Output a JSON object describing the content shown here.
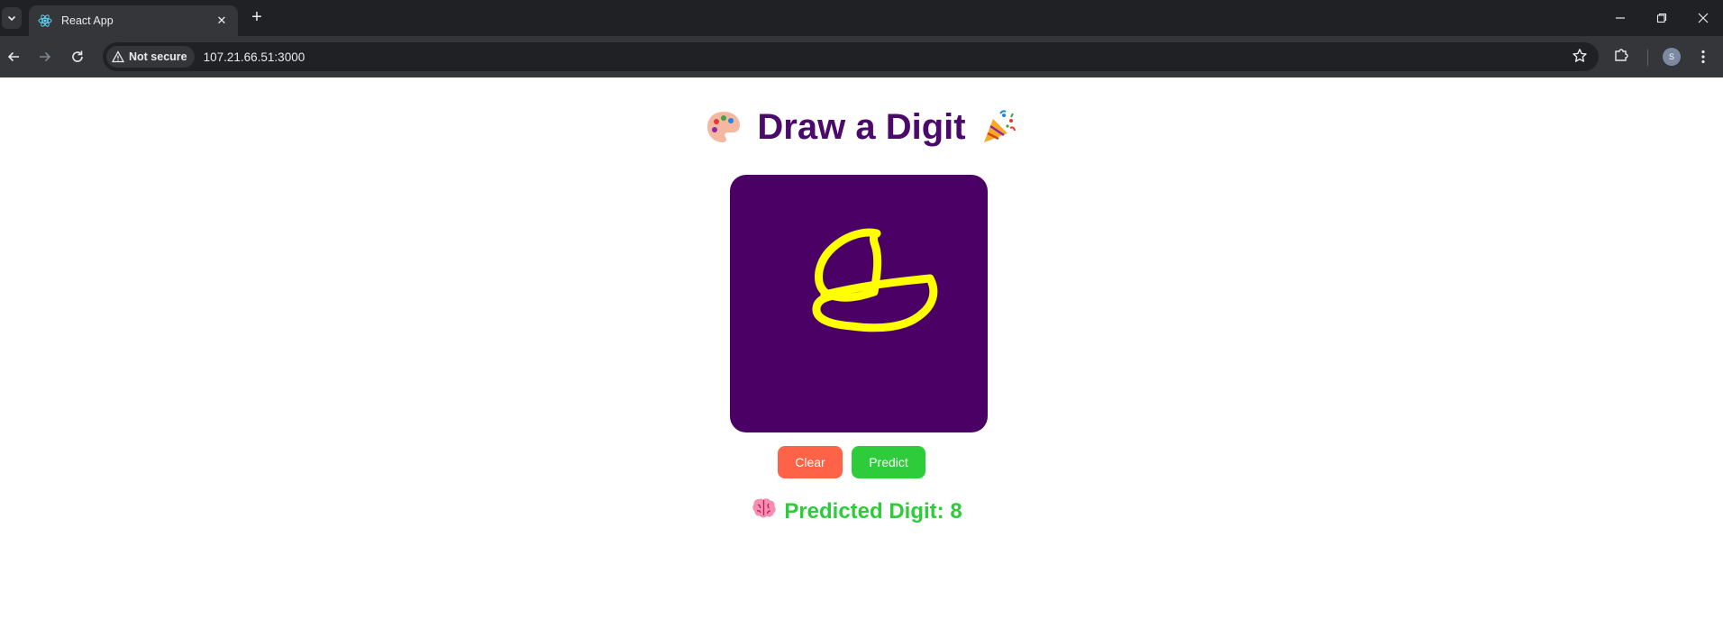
{
  "browser": {
    "tab_title": "React App",
    "security_label": "Not secure",
    "url": "107.21.66.51:3000",
    "profile_initial": "S"
  },
  "icons": {
    "tab_search": "chevron-down-icon",
    "favicon": "react-logo-icon",
    "tab_close": "close-icon",
    "new_tab": "plus-icon",
    "back": "back-arrow-icon",
    "forward": "forward-arrow-icon",
    "reload": "reload-icon",
    "warning": "warning-triangle-icon",
    "bookmark": "star-icon",
    "extensions": "puzzle-icon",
    "menu": "kebab-menu-icon",
    "palette": "palette-emoji",
    "party": "party-popper-emoji",
    "brain": "brain-emoji"
  },
  "app": {
    "title": "Draw a Digit",
    "clear_label": "Clear",
    "predict_label": "Predict",
    "result_label": "Predicted Digit: 8"
  },
  "colors": {
    "title": "#4b0a6b",
    "canvas_bg": "#4b0066",
    "stroke": "#ffff00",
    "clear_button": "#ff6347",
    "predict_button": "#2ecc3a",
    "result_text": "#2ecc3a"
  }
}
